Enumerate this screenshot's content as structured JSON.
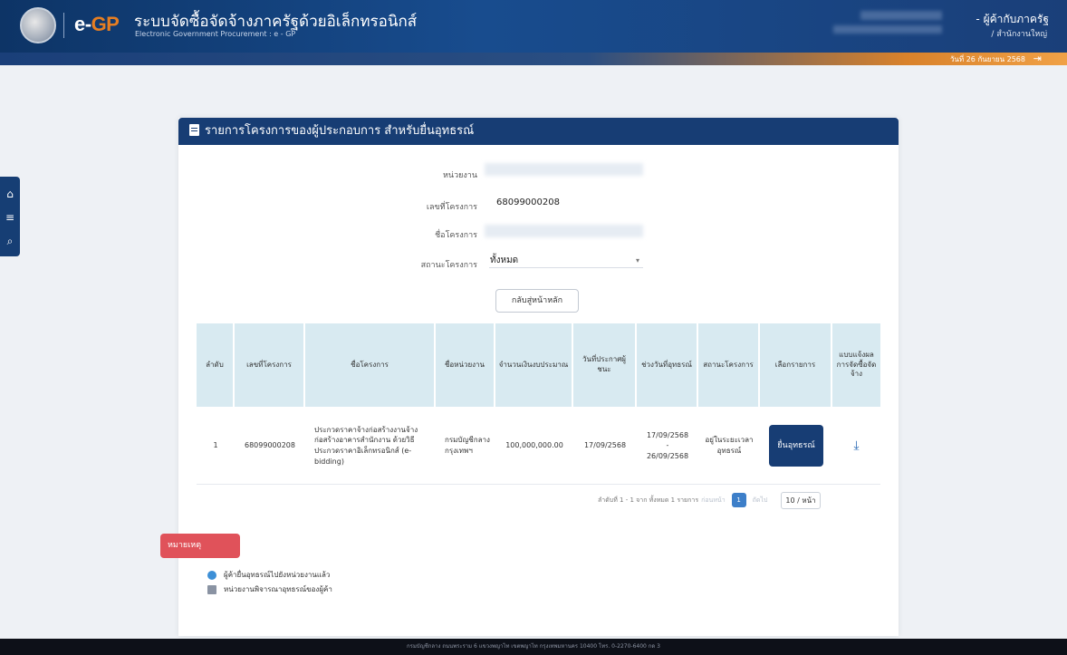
{
  "header": {
    "logo_e": "e-",
    "logo_gp": "GP",
    "system_title": "ระบบจัดซื้อจัดจ้างภาครัฐด้วยอิเล็กทรอนิกส์",
    "system_subtitle": "Electronic Government Procurement : e - GP",
    "user_role": "- ผู้ค้ากับภาครัฐ",
    "user_org": "/ สำนักงานใหญ่",
    "date_text": "วันที่ 26 กันยายน 2568",
    "colors": {
      "navy": "#173d74",
      "orange": "#d9822b"
    }
  },
  "sidebar": {
    "icons": [
      "home-icon",
      "menu-icon",
      "search-icon"
    ]
  },
  "card": {
    "title": "รายการโครงการของผู้ประกอบการ สำหรับยื่นอุทธรณ์",
    "fields": {
      "agency_label": "หน่วยงาน",
      "project_no_label": "เลขที่โครงการ",
      "project_no_value": "68099000208",
      "project_name_label": "ชื่อโครงการ",
      "status_label": "สถานะโครงการ",
      "status_value": "ทั้งหมด"
    },
    "back_button": "กลับสู่หน้าหลัก"
  },
  "table": {
    "headers": [
      "ลำดับ",
      "เลขที่โครงการ",
      "ชื่อโครงการ",
      "ชื่อหน่วยงาน",
      "จำนวนเงินงบประมาณ",
      "วันที่ประกาศผู้ชนะ",
      "ช่วงวันที่อุทธรณ์",
      "สถานะโครงการ",
      "เลือกรายการ",
      "แบบแจ้งผลการจัดซื้อจัดจ้าง"
    ],
    "rows": [
      {
        "no": "1",
        "project_no": "68099000208",
        "project_name": "ประกวดราคาจ้างก่อสร้างงานจ้างก่อสร้างอาคารสำนักงาน ด้วยวิธีประกวดราคาอิเล็กทรอนิกส์ (e-bidding)",
        "agency": "กรมบัญชีกลาง กรุงเทพฯ",
        "budget": "100,000,000.00",
        "announce_date": "17/09/2568",
        "appeal_from": "17/09/2568",
        "appeal_sep": "-",
        "appeal_to": "26/09/2568",
        "status": "อยู่ในระยะเวลาอุทธรณ์",
        "action_label": "ยื่นอุทธรณ์"
      }
    ]
  },
  "pagination": {
    "summary": "ลำดับที่ 1 - 1 จาก ทั้งหมด 1 รายการ",
    "prev": "ก่อนหน้า",
    "page": "1",
    "next": "ถัดไป",
    "page_size": "10 / หน้า"
  },
  "notes": {
    "title": "หมายเหตุ",
    "items": [
      "ผู้ค้ายื่นอุทธรณ์ไปยังหน่วยงานแล้ว",
      "หน่วยงานพิจารณาอุทธรณ์ของผู้ค้า"
    ]
  },
  "footer": {
    "text": "กรมบัญชีกลาง ถนนพระราม 6 แขวงพญาไท เขตพญาไท กรุงเทพมหานคร 10400 โทร. 0-2270-6400 กด 3"
  }
}
